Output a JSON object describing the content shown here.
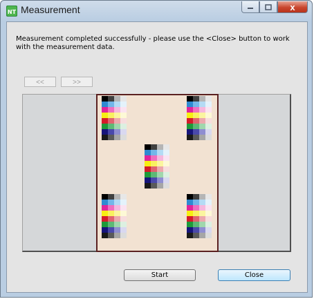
{
  "window": {
    "title": "Measurement",
    "app_icon_text": "NT"
  },
  "message": "Measurement completed successfully - please use the <Close> button to work with the measurement data.",
  "nav": {
    "prev_label": "<<",
    "next_label": ">>"
  },
  "buttons": {
    "start_label": "Start",
    "close_label": "Close"
  },
  "caption_buttons": {
    "close_glyph": "x"
  },
  "colors": {
    "title_bar": "#b9cde2",
    "sheet": "#f2e2d2",
    "sheet_border": "#5a2020",
    "panel": "#d5d7d9"
  },
  "patch_rows": [
    [
      "#000000",
      "#404040",
      "#b5b5b5",
      "#e7e7e7"
    ],
    [
      "#2f8ad1",
      "#73b6e9",
      "#b4dbf5",
      "#e4f2fb"
    ],
    [
      "#e0259a",
      "#ef6fbf",
      "#f6b7dd",
      "#fbe3f1"
    ],
    [
      "#f7ee12",
      "#f9f15f",
      "#fbf59f",
      "#fdf9d6"
    ],
    [
      "#d41b2a",
      "#e0636f",
      "#eca8ad",
      "#f7dcdd"
    ],
    [
      "#1e9a3a",
      "#5db976",
      "#a0d7ad",
      "#dcf0e1"
    ],
    [
      "#17157a",
      "#4a49ab",
      "#8f8ed1",
      "#d9d8f0"
    ],
    [
      "#1a1a1a",
      "#5a5a5a",
      "#a6a6a6",
      "#dcdcdc"
    ]
  ]
}
